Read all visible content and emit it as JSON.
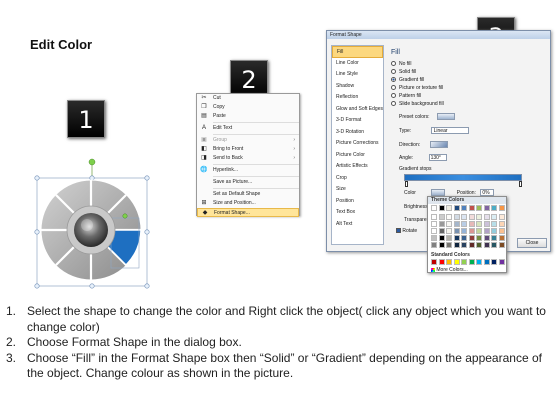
{
  "title": "Edit Color",
  "badges": [
    "1",
    "2",
    "3"
  ],
  "context_menu": {
    "items": [
      {
        "label": "Cut",
        "icon": "scissors-icon"
      },
      {
        "label": "Copy",
        "icon": "copy-icon"
      },
      {
        "label": "Paste",
        "icon": "paste-icon"
      },
      {
        "label": "Edit Text",
        "icon": "edit-text-icon"
      },
      {
        "label": "Group",
        "icon": "group-icon",
        "disabled": true
      },
      {
        "label": "Bring to Front",
        "icon": "bring-front-icon"
      },
      {
        "label": "Send to Back",
        "icon": "send-back-icon"
      },
      {
        "label": "Hyperlink...",
        "icon": "hyperlink-icon"
      },
      {
        "label": "Save as Picture...",
        "icon": "save-picture-icon"
      },
      {
        "label": "Set as Default Shape",
        "icon": "default-shape-icon"
      },
      {
        "label": "Size and Position...",
        "icon": "size-position-icon"
      },
      {
        "label": "Format Shape...",
        "icon": "format-shape-icon",
        "highlighted": true
      }
    ]
  },
  "dialog": {
    "title": "Format Shape",
    "nav": [
      "Fill",
      "Line Color",
      "Line Style",
      "Shadow",
      "Reflection",
      "Glow and Soft Edges",
      "3-D Format",
      "3-D Rotation",
      "Picture Corrections",
      "Picture Color",
      "Artistic Effects",
      "Crop",
      "Size",
      "Position",
      "Text Box",
      "Alt Text"
    ],
    "fill_heading": "Fill",
    "fill_options": [
      "No fill",
      "Solid fill",
      "Gradient fill",
      "Picture or texture fill",
      "Pattern fill",
      "Slide background fill"
    ],
    "selected_fill": "Gradient fill",
    "preset_colors_label": "Preset colors:",
    "type_label": "Type:",
    "type_value": "Linear",
    "direction_label": "Direction:",
    "angle_label": "Angle:",
    "angle_value": "130°",
    "gradient_stops_label": "Gradient stops",
    "color_label": "Color",
    "position_label": "Position:",
    "position_value": "0%",
    "brightness_label": "Brightness",
    "transparency_label": "Transparen",
    "rotate_label": "Rotate",
    "close_label": "Close"
  },
  "color_picker": {
    "theme_heading": "Theme Colors",
    "standard_heading": "Standard Colors",
    "more_colors": "More Colors...",
    "theme_top": [
      "#ffffff",
      "#000000",
      "#eeece1",
      "#1f497d",
      "#4f81bd",
      "#c0504d",
      "#9bbb59",
      "#8064a2",
      "#4bacc6",
      "#f79646"
    ],
    "standard": [
      "#c00000",
      "#ff0000",
      "#ffc000",
      "#ffff00",
      "#92d050",
      "#00b050",
      "#00b0f0",
      "#0070c0",
      "#002060",
      "#7030a0"
    ]
  },
  "instructions": [
    {
      "num": "1.",
      "text": "Select the shape to change the color and Right click the object( click any object which you want to change color)"
    },
    {
      "num": "2.",
      "text": "Choose Format Shape in the dialog box."
    },
    {
      "num": "3.",
      "text": "Choose “Fill” in the Format Shape box then “Solid” or “Gradient” depending on the appearance of the object. Change colour as shown in the picture."
    }
  ],
  "colors": {
    "accent": "#1e6fc1",
    "badge": "#000000",
    "highlight": "#ffe59a"
  }
}
